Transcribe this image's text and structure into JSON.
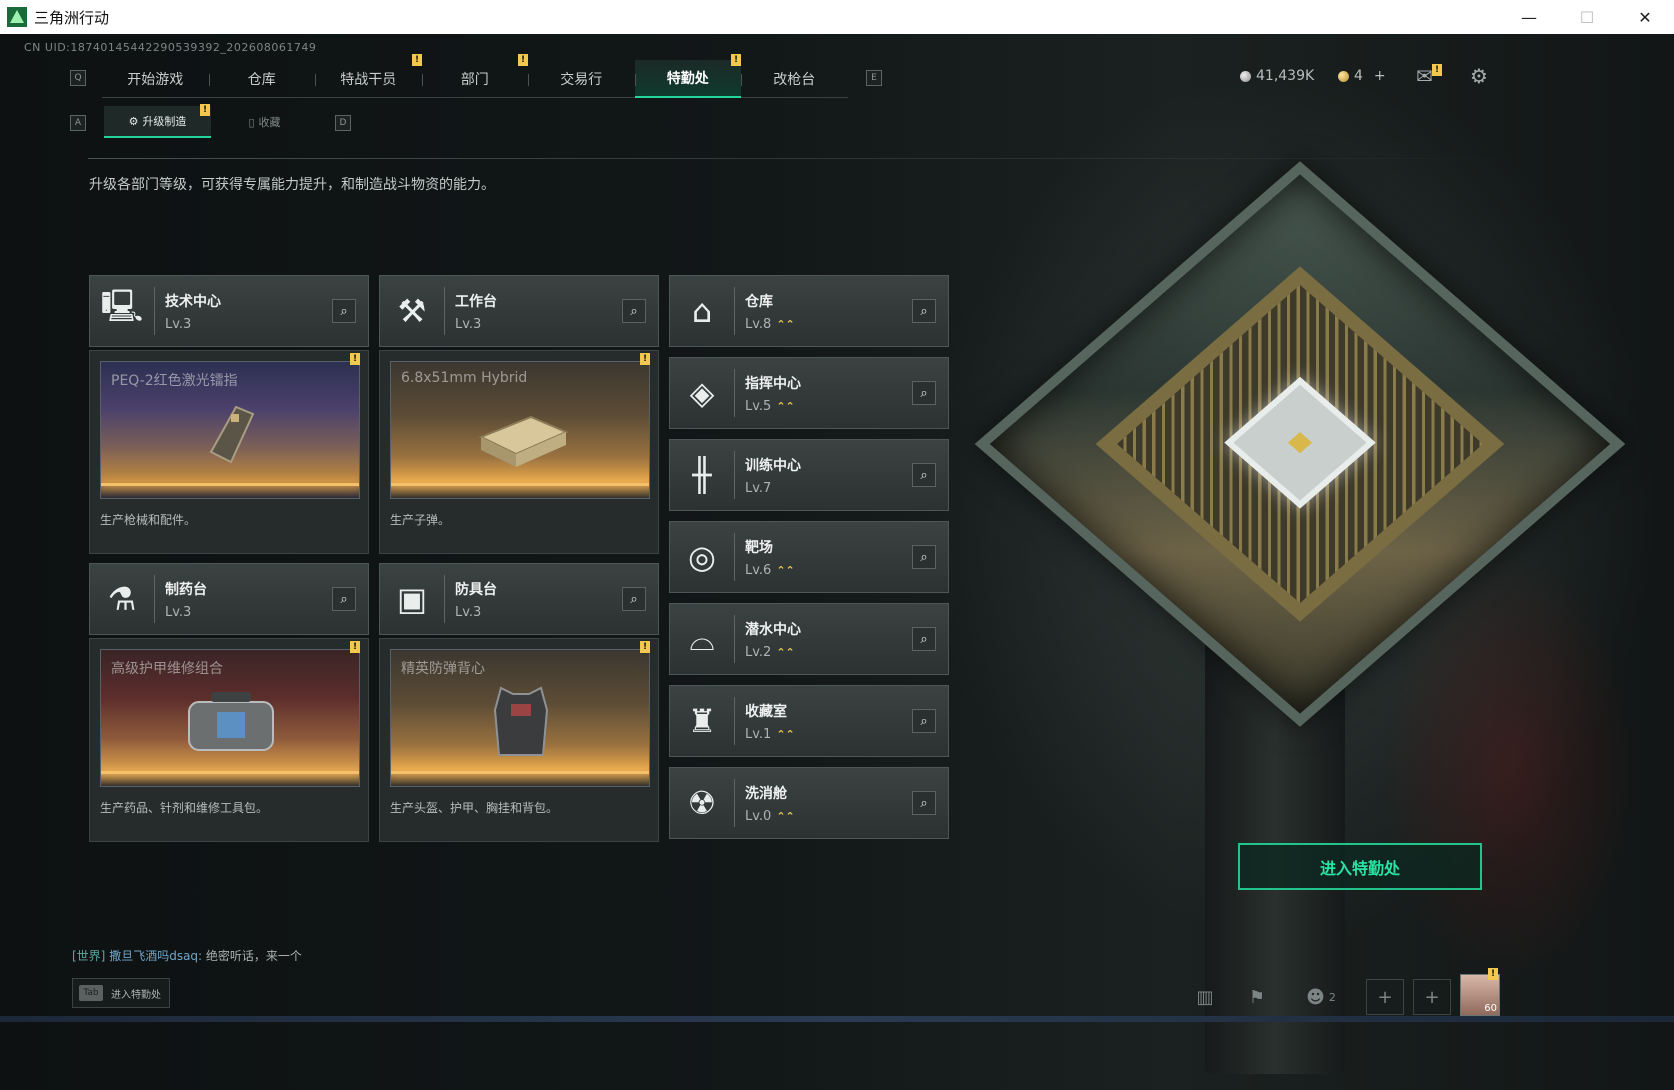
{
  "window": {
    "title": "三角洲行动",
    "min": "—",
    "max": "☐",
    "close": "✕"
  },
  "uid": "CN UID:18740145442290539392_202608061749",
  "nav": {
    "key_left": "Q",
    "key_right": "E",
    "tabs": [
      {
        "label": "开始游戏",
        "alert": false
      },
      {
        "label": "仓库",
        "alert": false
      },
      {
        "label": "特战干员",
        "alert": true
      },
      {
        "label": "部门",
        "alert": true
      },
      {
        "label": "交易行",
        "alert": false
      },
      {
        "label": "特勤处",
        "alert": true,
        "active": true
      },
      {
        "label": "改枪台",
        "alert": false
      }
    ]
  },
  "currency": {
    "silver": "41,439K",
    "gold": "4",
    "add": "+"
  },
  "subnav": {
    "key_left": "A",
    "key_right": "D",
    "tabs": [
      {
        "label": "升级制造",
        "icon": "gear-icon",
        "active": true
      },
      {
        "label": "收藏",
        "icon": "archive-icon",
        "active": false
      }
    ]
  },
  "description": "升级各部门等级，可获得专属能力提升，和制造战斗物资的能力。",
  "facilities_left": [
    {
      "name": "技术中心",
      "level": "Lv.3",
      "icon": "monitor-icon"
    },
    {
      "name": "工作台",
      "level": "Lv.3",
      "icon": "tools-icon"
    },
    {
      "name": "制药台",
      "level": "Lv.3",
      "icon": "microscope-icon"
    },
    {
      "name": "防具台",
      "level": "Lv.3",
      "icon": "armor-blocks-icon"
    }
  ],
  "products": [
    {
      "name": "PEQ-2红色激光镭指",
      "desc": "生产枪械和配件。",
      "alert": "!"
    },
    {
      "name": "6.8x51mm Hybrid",
      "desc": "生产子弹。",
      "alert": "!"
    },
    {
      "name": "高级护甲维修组合",
      "desc": "生产药品、针剂和维修工具包。",
      "alert": "!"
    },
    {
      "name": "精英防弹背心",
      "desc": "生产头盔、护甲、胸挂和背包。",
      "alert": "!"
    }
  ],
  "facilities_right": [
    {
      "name": "仓库",
      "level": "Lv.8",
      "upgrade": "⌃⌃",
      "icon": "warehouse-icon"
    },
    {
      "name": "指挥中心",
      "level": "Lv.5",
      "upgrade": "⌃⌃",
      "icon": "command-icon"
    },
    {
      "name": "训练中心",
      "level": "Lv.7",
      "upgrade": "",
      "icon": "dumbbell-icon"
    },
    {
      "name": "靶场",
      "level": "Lv.6",
      "upgrade": "⌃⌃",
      "icon": "target-icon"
    },
    {
      "name": "潜水中心",
      "level": "Lv.2",
      "upgrade": "⌃⌃",
      "icon": "diving-mask-icon"
    },
    {
      "name": "收藏室",
      "level": "Lv.1",
      "upgrade": "⌃⌃",
      "icon": "trophy-room-icon"
    },
    {
      "name": "洗消舱",
      "level": "Lv.0",
      "upgrade": "⌃⌃",
      "icon": "decon-icon"
    }
  ],
  "enter_button": "进入特勤处",
  "chat": {
    "channel": "[世界]",
    "user": "撒旦飞酒吗dsaq:",
    "message": "绝密听话，来一个"
  },
  "tab_hint": {
    "key": "Tab",
    "label": "进入特勤处"
  },
  "bottom": {
    "friends_count": "2",
    "avatar_level": "60"
  },
  "colors": {
    "accent": "#25d49c",
    "alert": "#f2c94c"
  }
}
